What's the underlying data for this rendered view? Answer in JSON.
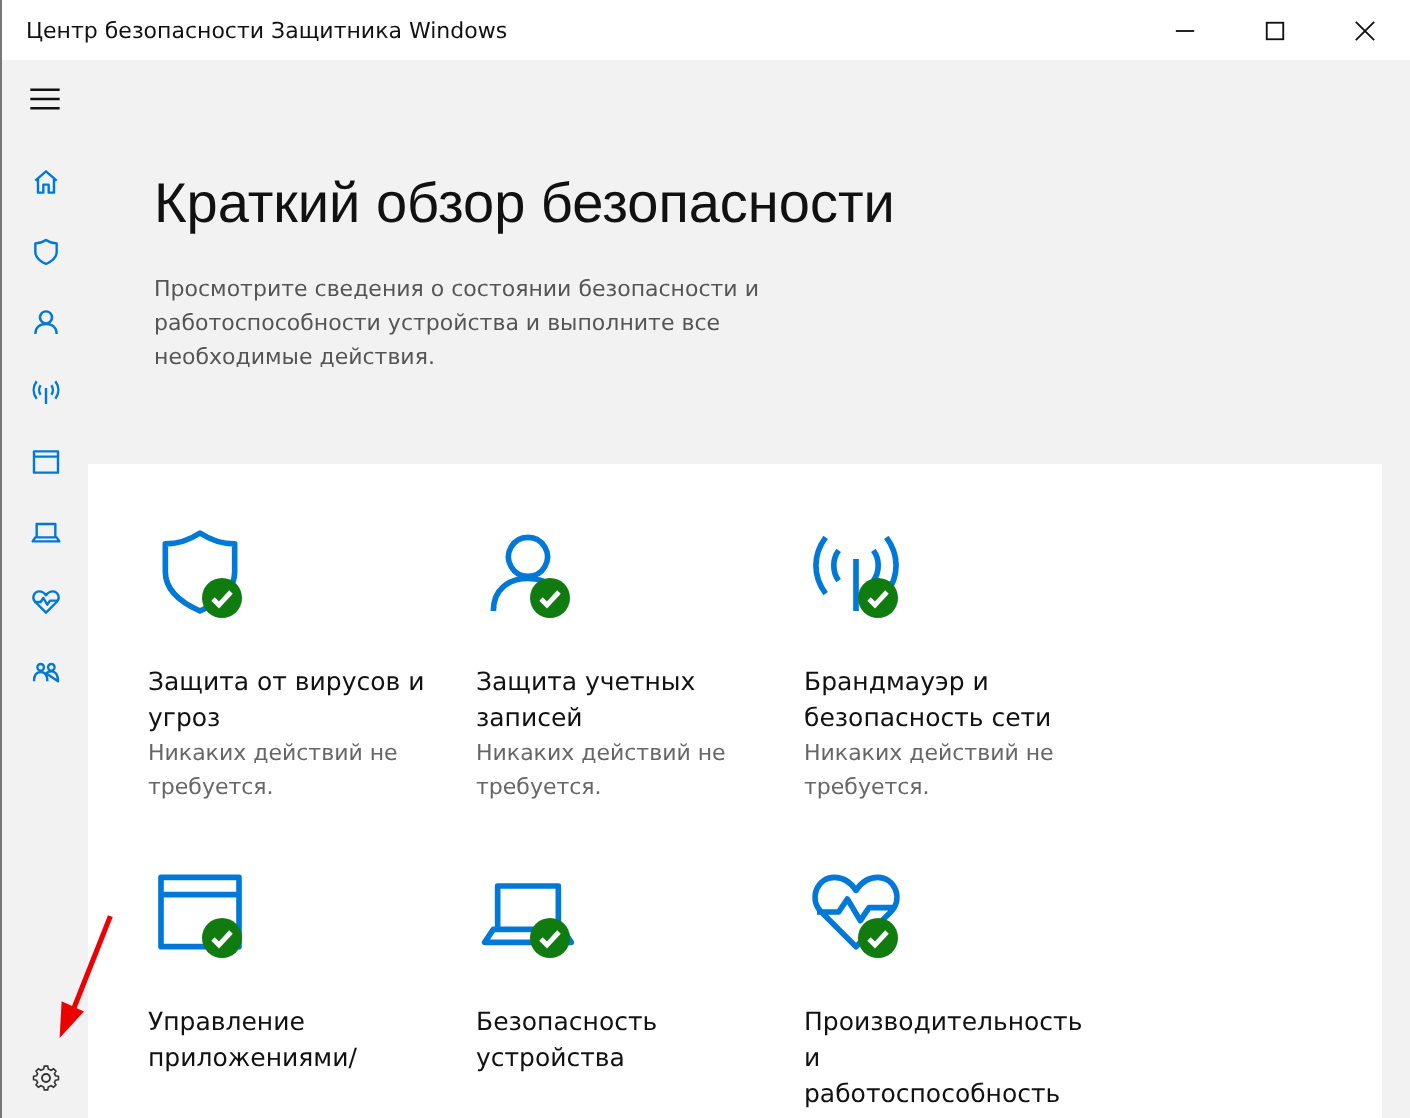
{
  "window": {
    "title": "Центр безопасности Защитника Windows"
  },
  "sidebar": {
    "items": [
      {
        "kind": "home"
      },
      {
        "kind": "shield"
      },
      {
        "kind": "person"
      },
      {
        "kind": "antenna"
      },
      {
        "kind": "window"
      },
      {
        "kind": "laptop"
      },
      {
        "kind": "heart"
      },
      {
        "kind": "family"
      }
    ]
  },
  "header": {
    "title": "Краткий обзор безопасности",
    "description": "Просмотрите сведения о состоянии безопасности и работоспособности устройства и выполните все необходимые действия."
  },
  "cards": [
    {
      "kind": "shield",
      "title": "Защита от вирусов и угроз",
      "status": "Никаких действий не требуется.",
      "ok": true
    },
    {
      "kind": "person",
      "title": "Защита учетных записей",
      "status": "Никаких действий не требуется.",
      "ok": true
    },
    {
      "kind": "antenna",
      "title": "Брандмауэр и безопасность сети",
      "status": "Никаких действий не требуется.",
      "ok": true
    },
    {
      "kind": "window",
      "title": "Управление приложениями/",
      "ok": true
    },
    {
      "kind": "laptop",
      "title": "Безопасность устройства",
      "ok": true
    },
    {
      "kind": "heart",
      "title": "Производительность и работоспособность",
      "ok": true
    }
  ]
}
